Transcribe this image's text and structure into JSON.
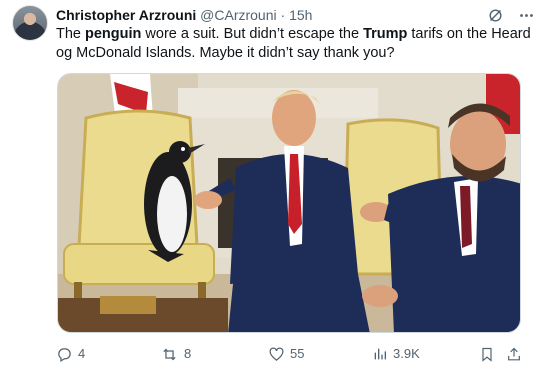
{
  "tweet": {
    "author_name": "Christopher Arzrouni",
    "handle": "@CArzrouni",
    "separator": "·",
    "time": "15h",
    "text_parts": {
      "p1": "The ",
      "b1": "penguin",
      "p2": " wore a suit. But didn’t escape the ",
      "b2": "Trump",
      "p3": " tarifs on the Heard og McDonald Islands. Maybe it didn’t say thank you?"
    }
  },
  "header_icons": [
    "grok-icon",
    "more-icon"
  ],
  "actions": {
    "replies": "4",
    "reposts": "8",
    "likes": "55",
    "views": "3.9K"
  },
  "action_icons": [
    "reply-icon",
    "repost-icon",
    "like-icon",
    "views-icon",
    "bookmark-icon",
    "share-icon"
  ],
  "colors": {
    "text": "#0f1419",
    "muted": "#536471",
    "border": "#cfd9de"
  }
}
